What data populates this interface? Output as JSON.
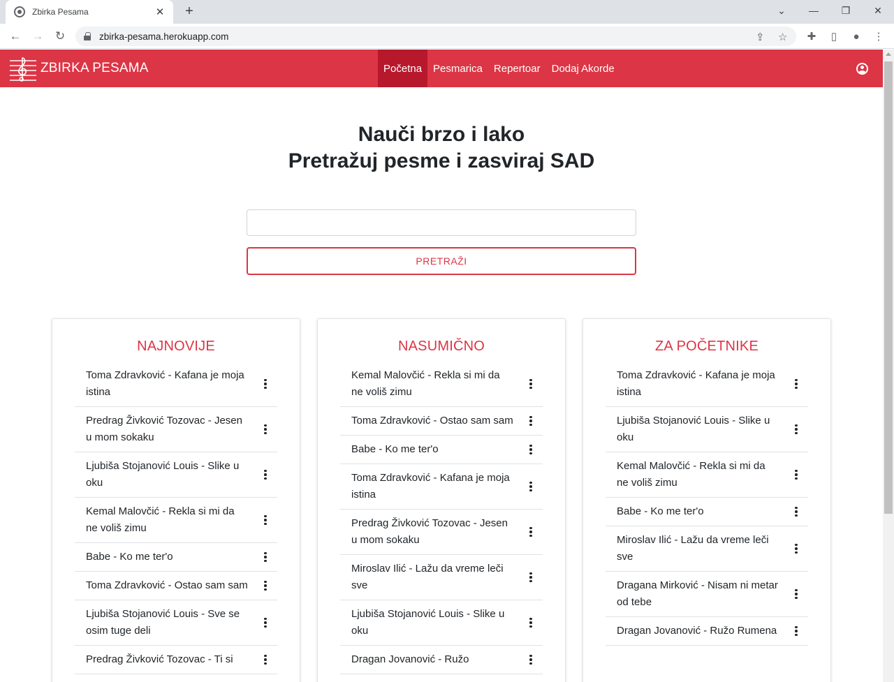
{
  "browser": {
    "tab_title": "Zbirka Pesama",
    "url": "zbirka-pesama.herokuapp.com"
  },
  "navbar": {
    "brand": "ZBIRKA PESAMA",
    "links": [
      "Početna",
      "Pesmarica",
      "Repertoar",
      "Dodaj Akorde"
    ],
    "active_index": 0,
    "accent_color": "#dc3545"
  },
  "hero": {
    "line1": "Nauči brzo i lako",
    "line2": "Pretražuj pesme i zasviraj SAD"
  },
  "search": {
    "value": "",
    "button_label": "PRETRAŽI"
  },
  "cards": [
    {
      "title": "NAJNOVIJE",
      "songs": [
        "Toma Zdravković - Kafana je moja istina",
        "Predrag Živković Tozovac - Jesen u mom sokaku",
        "Ljubiša Stojanović Louis - Slike u oku",
        "Kemal Malovčić - Rekla si mi da ne voliš zimu",
        "Babe - Ko me ter'o",
        "Toma Zdravković - Ostao sam sam",
        "Ljubiša Stojanović Louis - Sve se osim tuge deli",
        "Predrag Živković Tozovac - Ti si"
      ]
    },
    {
      "title": "NASUMIČNO",
      "songs": [
        "Kemal Malovčić - Rekla si mi da ne voliš zimu",
        "Toma Zdravković - Ostao sam sam",
        "Babe - Ko me ter'o",
        "Toma Zdravković - Kafana je moja istina",
        "Predrag Živković Tozovac - Jesen u mom sokaku",
        "Miroslav Ilić - Lažu da vreme leči sve",
        "Ljubiša Stojanović Louis - Slike u oku",
        "Dragan Jovanović - Ružo"
      ]
    },
    {
      "title": "ZA POČETNIKE",
      "songs": [
        "Toma Zdravković - Kafana je moja istina",
        "Ljubiša Stojanović Louis - Slike u oku",
        "Kemal Malovčić - Rekla si mi da ne voliš zimu",
        "Babe - Ko me ter'o",
        "Miroslav Ilić - Lažu da vreme leči sve",
        "Dragana Mirković - Nisam ni metar od tebe",
        "Dragan Jovanović - Ružo Rumena"
      ]
    }
  ]
}
